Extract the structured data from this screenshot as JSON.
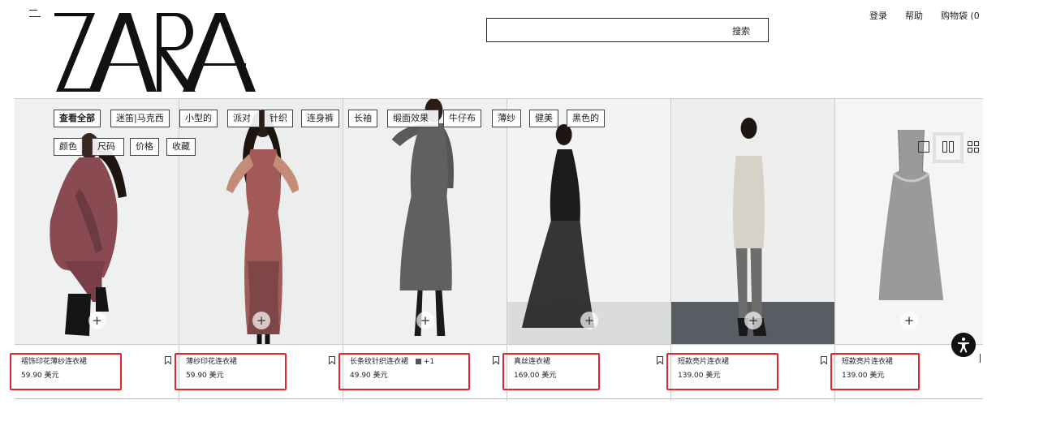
{
  "header": {
    "logo_text": "ZARA",
    "menu_icon": "hamburger-menu-icon",
    "search_label": "搜索",
    "nav": {
      "login": "登录",
      "help": "帮助",
      "cart": "购物袋 (0)"
    }
  },
  "filters": {
    "row1": [
      "查看全部",
      "迷笛|马克西",
      "小型的",
      "派对",
      "针织",
      "连身裤",
      "长袖",
      "缎面效果",
      "牛仔布",
      "薄纱",
      "健美",
      "黑色的"
    ],
    "row2": [
      "颜色",
      "尺码",
      "价格",
      "收藏"
    ]
  },
  "products": [
    {
      "name": "褶饰印花薄纱连衣裙",
      "price": "59.90 美元",
      "swatch": ""
    },
    {
      "name": "薄纱印花连衣裙",
      "price": "59.90 美元",
      "swatch": ""
    },
    {
      "name": "长条纹针织连衣裙",
      "price": "49.90 美元",
      "swatch": "+1"
    },
    {
      "name": "真丝连衣裙",
      "price": "169.00 美元",
      "swatch": ""
    },
    {
      "name": "短款亮片连衣裙",
      "price": "139.00 美元",
      "swatch": ""
    },
    {
      "name": "短款亮片连衣裙",
      "price": "139.00 美元",
      "swatch": ""
    }
  ],
  "icons": {
    "add": "plus-icon",
    "save": "bookmark-icon",
    "view_single": "single-view-icon",
    "view_double": "double-view-icon",
    "view_grid": "grid-view-icon",
    "accessibility": "accessibility-icon"
  },
  "colors": {
    "highlight": "#e0262b",
    "text": "#222222",
    "border": "#cccccc"
  }
}
